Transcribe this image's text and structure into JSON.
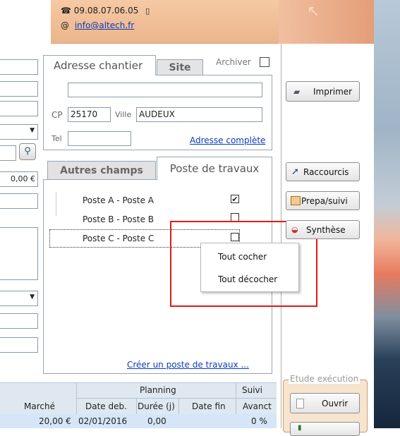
{
  "header": {
    "phone": "09.08.07.06.05",
    "email_prefix": "@",
    "email": "info@altech.fr"
  },
  "left": {
    "amount": "0,00 €"
  },
  "address_panel": {
    "tab_active": "Adresse chantier",
    "tab_inactive": "Site",
    "archive_label": "Archiver",
    "cp_label": "CP",
    "cp_value": "25170",
    "ville_label": "Ville",
    "ville_value": "AUDEUX",
    "tel_label": "Tel",
    "full_address_link": "Adresse complète"
  },
  "works_panel": {
    "tab_inactive": "Autres champs",
    "tab_active": "Poste de travaux",
    "items": [
      {
        "label": "Poste A - Poste A",
        "checked": true
      },
      {
        "label": "Poste B - Poste B",
        "checked": false
      },
      {
        "label": "Poste C - Poste C",
        "checked": false
      }
    ],
    "create_link": "Créer un poste de travaux ..."
  },
  "context_menu": {
    "check_all": "Tout cocher",
    "uncheck_all": "Tout décocher"
  },
  "side_buttons": {
    "print": "Imprimer",
    "shortcuts": "Raccourcis",
    "prep": "Prepa/suivi",
    "synthesis": "Synthèse"
  },
  "execution_group": {
    "legend": "Etude exécution",
    "open": "Ouvrir"
  },
  "table": {
    "group_planning": "Planning",
    "group_suivi": "Suivi",
    "columns": [
      "Marché",
      "Date deb.",
      "Durée (j)",
      "Date fin",
      "Avanct"
    ],
    "rows": [
      {
        "marche": "20,00 €",
        "date_deb": "02/01/2016",
        "duree": "0,00",
        "date_fin": "",
        "avanct": "0 %"
      }
    ]
  },
  "colors": {
    "header_bg": "#eab58c",
    "highlight_border": "#e01818",
    "link": "#0a3bbf",
    "table_header_bg": "#dfe8f1",
    "table_row_bg": "#d4e6f7"
  }
}
